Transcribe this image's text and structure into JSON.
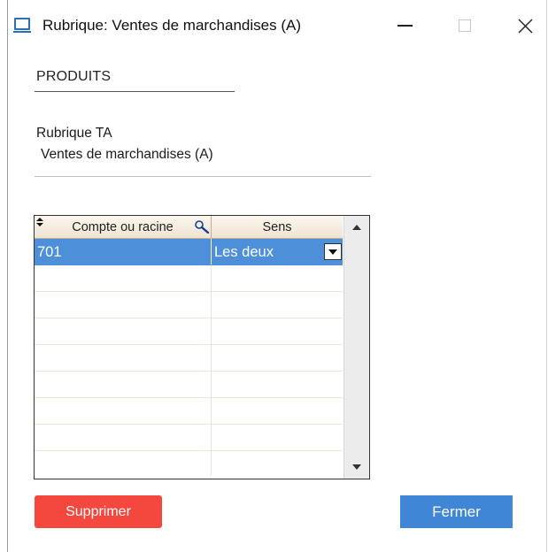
{
  "window": {
    "title": "Rubrique: Ventes de marchandises  (A)",
    "icon": "window-app-icon",
    "controls": [
      "minimize-icon",
      "maximize-icon",
      "close-icon"
    ]
  },
  "section": {
    "title": "PRODUITS"
  },
  "rubrique": {
    "label": "Rubrique TA",
    "value": "Ventes de marchandises  (A)"
  },
  "grid": {
    "columns": [
      {
        "label": "Compte ou racine",
        "icons": [
          "sort-icon",
          "search-icon"
        ]
      },
      {
        "label": "Sens"
      }
    ],
    "rows": [
      {
        "compte": "701",
        "sens": "Les deux",
        "selected": true
      }
    ],
    "empty_rows": 8
  },
  "buttons": {
    "delete_label": "Supprimer",
    "close_label": "Fermer"
  },
  "colors": {
    "delete_button": "#f4473d",
    "close_button": "#3f86d6",
    "selected_row": "#4d8fd9",
    "grid_header": "#efe4d2"
  }
}
